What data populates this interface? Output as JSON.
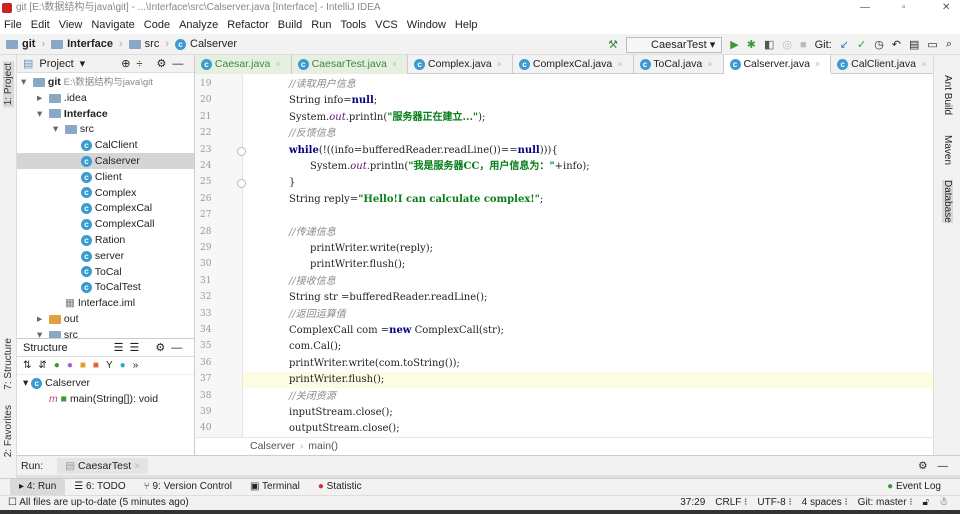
{
  "window": {
    "title": "git [E:\\数据结构与java\\git] - ...\\Interface\\src\\Calserver.java [Interface] - IntelliJ IDEA"
  },
  "menu": [
    "File",
    "Edit",
    "View",
    "Navigate",
    "Code",
    "Analyze",
    "Refactor",
    "Build",
    "Run",
    "Tools",
    "VCS",
    "Window",
    "Help"
  ],
  "navbar": {
    "crumbs": [
      "git",
      "Interface",
      "src",
      "Calserver"
    ],
    "run_config": "CaesarTest",
    "git_label": "Git:"
  },
  "project": {
    "title": "Project",
    "tree": [
      {
        "label": "git",
        "extra": "E:\\数据结构与java\\git",
        "depth": 0,
        "type": "module",
        "open": true
      },
      {
        "label": ".idea",
        "depth": 1,
        "type": "folder",
        "open": false
      },
      {
        "label": "Interface",
        "depth": 1,
        "type": "module",
        "open": true
      },
      {
        "label": "src",
        "depth": 2,
        "type": "folder",
        "open": true
      },
      {
        "label": "CalClient",
        "depth": 3,
        "type": "class"
      },
      {
        "label": "Calserver",
        "depth": 3,
        "type": "class",
        "selected": true
      },
      {
        "label": "Client",
        "depth": 3,
        "type": "class"
      },
      {
        "label": "Complex",
        "depth": 3,
        "type": "class"
      },
      {
        "label": "ComplexCal",
        "depth": 3,
        "type": "class"
      },
      {
        "label": "ComplexCall",
        "depth": 3,
        "type": "class"
      },
      {
        "label": "Ration",
        "depth": 3,
        "type": "class"
      },
      {
        "label": "server",
        "depth": 3,
        "type": "class"
      },
      {
        "label": "ToCal",
        "depth": 3,
        "type": "class"
      },
      {
        "label": "ToCalTest",
        "depth": 3,
        "type": "class"
      },
      {
        "label": "Interface.iml",
        "depth": 2,
        "type": "file"
      },
      {
        "label": "out",
        "depth": 1,
        "type": "folder-orange",
        "open": false
      },
      {
        "label": "src",
        "depth": 1,
        "type": "folder",
        "open": true
      }
    ]
  },
  "structure": {
    "title": "Structure",
    "class": "Calserver",
    "method": "main(String[]): void"
  },
  "tabs": [
    {
      "label": "Caesar.java",
      "green": true
    },
    {
      "label": "CaesarTest.java",
      "green": true
    },
    {
      "label": "Complex.java"
    },
    {
      "label": "ComplexCal.java"
    },
    {
      "label": "ToCal.java"
    },
    {
      "label": "Calserver.java",
      "active": true
    },
    {
      "label": "CalClient.java"
    }
  ],
  "code": [
    {
      "n": "19",
      "i": 2,
      "t": [
        [
          "cm",
          "//读取用户信息"
        ]
      ]
    },
    {
      "n": "20",
      "i": 2,
      "t": [
        [
          "",
          "String info="
        ],
        [
          "kw",
          "null"
        ],
        [
          "",
          ";"
        ]
      ]
    },
    {
      "n": "21",
      "i": 2,
      "t": [
        [
          "",
          "System."
        ],
        [
          "fi",
          "out"
        ],
        [
          "",
          ".println("
        ],
        [
          "st",
          "\"服务器正在建立...\""
        ],
        [
          "",
          ");"
        ]
      ]
    },
    {
      "n": "22",
      "i": 2,
      "t": [
        [
          "cm",
          "//反馈信息"
        ]
      ]
    },
    {
      "n": "23",
      "i": 2,
      "t": [
        [
          "kw",
          "while"
        ],
        [
          "",
          "(!((info=bufferedReader.readLine())=="
        ],
        [
          "kw",
          "null"
        ],
        [
          "",
          "))){"
        ]
      ]
    },
    {
      "n": "24",
      "i": 3,
      "t": [
        [
          "",
          "System."
        ],
        [
          "fi",
          "out"
        ],
        [
          "",
          ".println("
        ],
        [
          "st",
          "\"我是服务器CC，用户信息为：\""
        ],
        [
          "",
          "+info);"
        ]
      ]
    },
    {
      "n": "25",
      "i": 2,
      "t": [
        [
          "",
          "}"
        ]
      ]
    },
    {
      "n": "26",
      "i": 2,
      "t": [
        [
          "",
          "String reply="
        ],
        [
          "st",
          "\"Hello!I can calculate complex!\""
        ],
        [
          "",
          ";"
        ]
      ]
    },
    {
      "n": "27",
      "i": 2,
      "t": []
    },
    {
      "n": "28",
      "i": 2,
      "t": [
        [
          "cm",
          "//传递信息"
        ]
      ]
    },
    {
      "n": "29",
      "i": 3,
      "t": [
        [
          "",
          "printWriter.write(reply);"
        ]
      ]
    },
    {
      "n": "30",
      "i": 3,
      "t": [
        [
          "",
          "printWriter.flush();"
        ]
      ]
    },
    {
      "n": "31",
      "i": 2,
      "t": [
        [
          "cm",
          "//接收信息"
        ]
      ]
    },
    {
      "n": "32",
      "i": 2,
      "t": [
        [
          "",
          "String str =bufferedReader.readLine();"
        ]
      ]
    },
    {
      "n": "33",
      "i": 2,
      "t": [
        [
          "cm",
          "//返回运算值"
        ]
      ]
    },
    {
      "n": "34",
      "i": 2,
      "t": [
        [
          "",
          "ComplexCall com ="
        ],
        [
          "kw",
          "new"
        ],
        [
          "",
          " ComplexCall(str);"
        ]
      ]
    },
    {
      "n": "35",
      "i": 2,
      "t": [
        [
          "",
          "com.Cal();"
        ]
      ]
    },
    {
      "n": "36",
      "i": 2,
      "t": [
        [
          "",
          "printWriter.write(com.toString());"
        ]
      ]
    },
    {
      "n": "37",
      "i": 2,
      "t": [
        [
          "",
          "printWriter.flush();"
        ]
      ],
      "current": true
    },
    {
      "n": "38",
      "i": 2,
      "t": [
        [
          "cm",
          "//关闭资源"
        ]
      ]
    },
    {
      "n": "39",
      "i": 2,
      "t": [
        [
          "",
          "inputStream.close();"
        ]
      ]
    },
    {
      "n": "40",
      "i": 2,
      "t": [
        [
          "",
          "outputStream.close();"
        ]
      ]
    }
  ],
  "editor_breadcrumb": [
    "Calserver",
    "main()"
  ],
  "left_stripe": [
    "1: Project",
    "7: Structure",
    "2: Favorites"
  ],
  "right_stripe": [
    "Ant Build",
    "Maven",
    "Database"
  ],
  "run": {
    "label": "Run:",
    "config": "CaesarTest"
  },
  "bottom_tabs": [
    "4: Run",
    "6: TODO",
    "9: Version Control",
    "Terminal",
    "Statistic"
  ],
  "event_log": "Event Log",
  "status": {
    "message": "All files are up-to-date (5 minutes ago)",
    "position": "37:29",
    "line_sep": "CRLF",
    "encoding": "UTF-8",
    "indent": "4 spaces",
    "git": "Git: master"
  }
}
